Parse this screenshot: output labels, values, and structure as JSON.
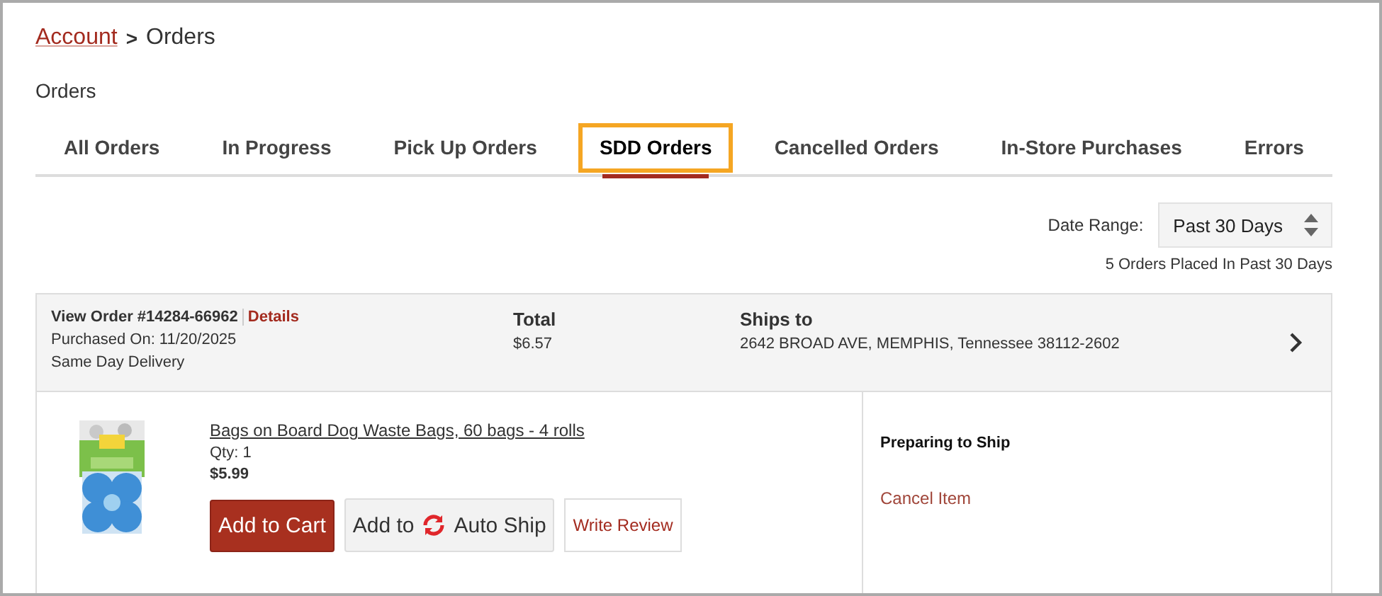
{
  "breadcrumb": {
    "link": "Account",
    "separator": ">",
    "current": "Orders"
  },
  "heading": "Orders",
  "tabs": [
    {
      "label": "All Orders",
      "selected": false,
      "highlighted": false
    },
    {
      "label": "In Progress",
      "selected": false,
      "highlighted": false
    },
    {
      "label": "Pick Up Orders",
      "selected": false,
      "highlighted": false
    },
    {
      "label": "SDD Orders",
      "selected": true,
      "highlighted": true
    },
    {
      "label": "Cancelled Orders",
      "selected": false,
      "highlighted": false
    },
    {
      "label": "In-Store Purchases",
      "selected": false,
      "highlighted": false
    },
    {
      "label": "Errors",
      "selected": false,
      "highlighted": false
    }
  ],
  "date_range": {
    "label": "Date Range:",
    "value": "Past 30 Days",
    "summary": "5 Orders Placed In Past 30 Days"
  },
  "order": {
    "view_order": "View Order #14284-66962",
    "details_link": "Details",
    "purchased_on": "Purchased On: 11/20/2025",
    "delivery": "Same Day Delivery",
    "total_label": "Total",
    "total": "$6.57",
    "ships_to_label": "Ships to",
    "address": "2642 BROAD AVE, MEMPHIS, Tennessee 38112-2602",
    "items": [
      {
        "name": "Bags on Board Dog Waste Bags, 60 bags - 4 rolls",
        "qty": "Qty: 1",
        "price": "$5.99",
        "add_to_cart": "Add to Cart",
        "auto_ship_prefix": "Add to",
        "auto_ship_suffix": "Auto Ship",
        "write_review": "Write Review",
        "status": "Preparing to Ship",
        "cancel": "Cancel Item"
      }
    ]
  }
}
